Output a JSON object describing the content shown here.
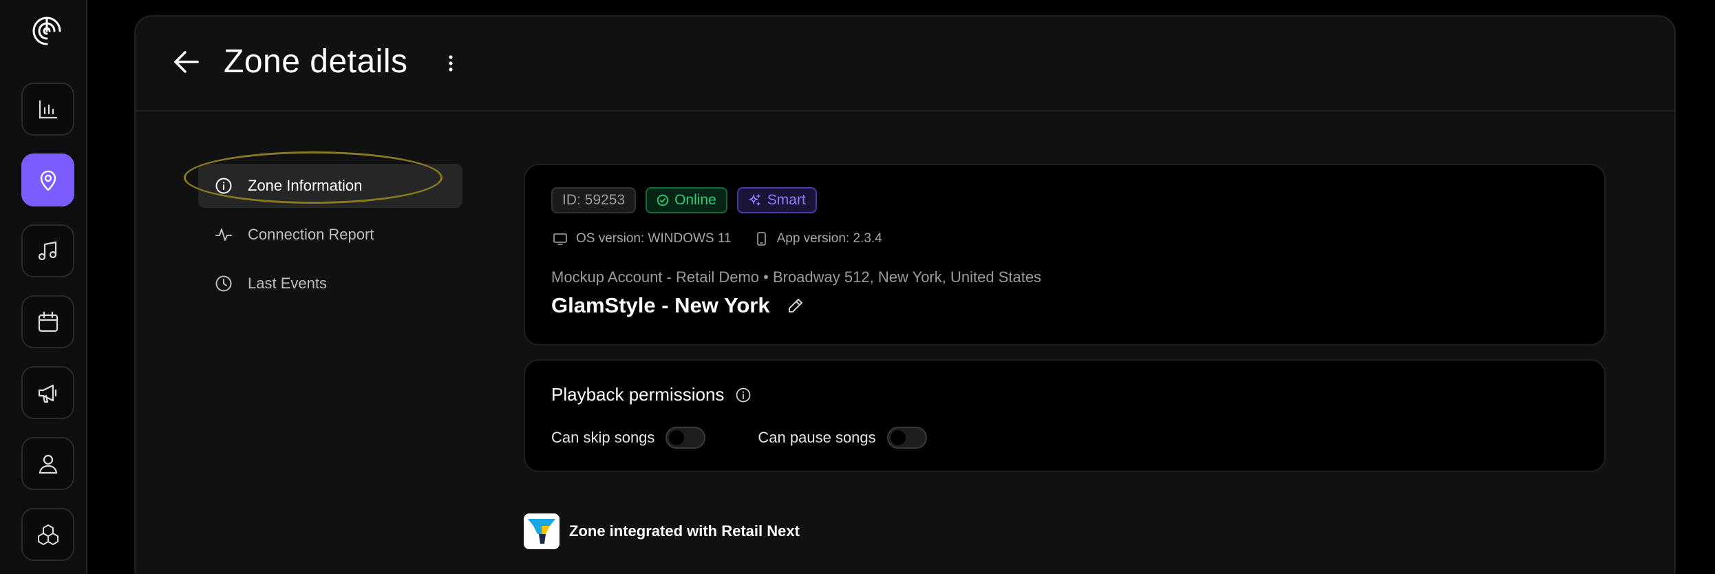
{
  "header": {
    "title": "Zone details"
  },
  "nav": {
    "items": [
      {
        "label": "Zone Information",
        "icon": "info-icon",
        "active": true
      },
      {
        "label": "Connection Report",
        "icon": "activity-icon",
        "active": false
      },
      {
        "label": "Last Events",
        "icon": "clock-icon",
        "active": false
      }
    ]
  },
  "zone": {
    "id_badge": "ID: 59253",
    "status_badge": "Online",
    "type_badge": "Smart",
    "os_version": "OS version: WINDOWS 11",
    "app_version": "App version: 2.3.4",
    "account_line": "Mockup Account - Retail Demo • Broadway 512, New York, United States",
    "name": "GlamStyle - New York"
  },
  "permissions": {
    "title": "Playback permissions",
    "skip_label": "Can skip songs",
    "skip_enabled": false,
    "pause_label": "Can pause songs",
    "pause_enabled": false
  },
  "integration": {
    "label": "Zone integrated with Retail Next"
  },
  "colors": {
    "accent": "#7b5cff",
    "online": "#25d07a",
    "smart": "#8d7cff",
    "highlight_ring": "#8a7a1f"
  }
}
